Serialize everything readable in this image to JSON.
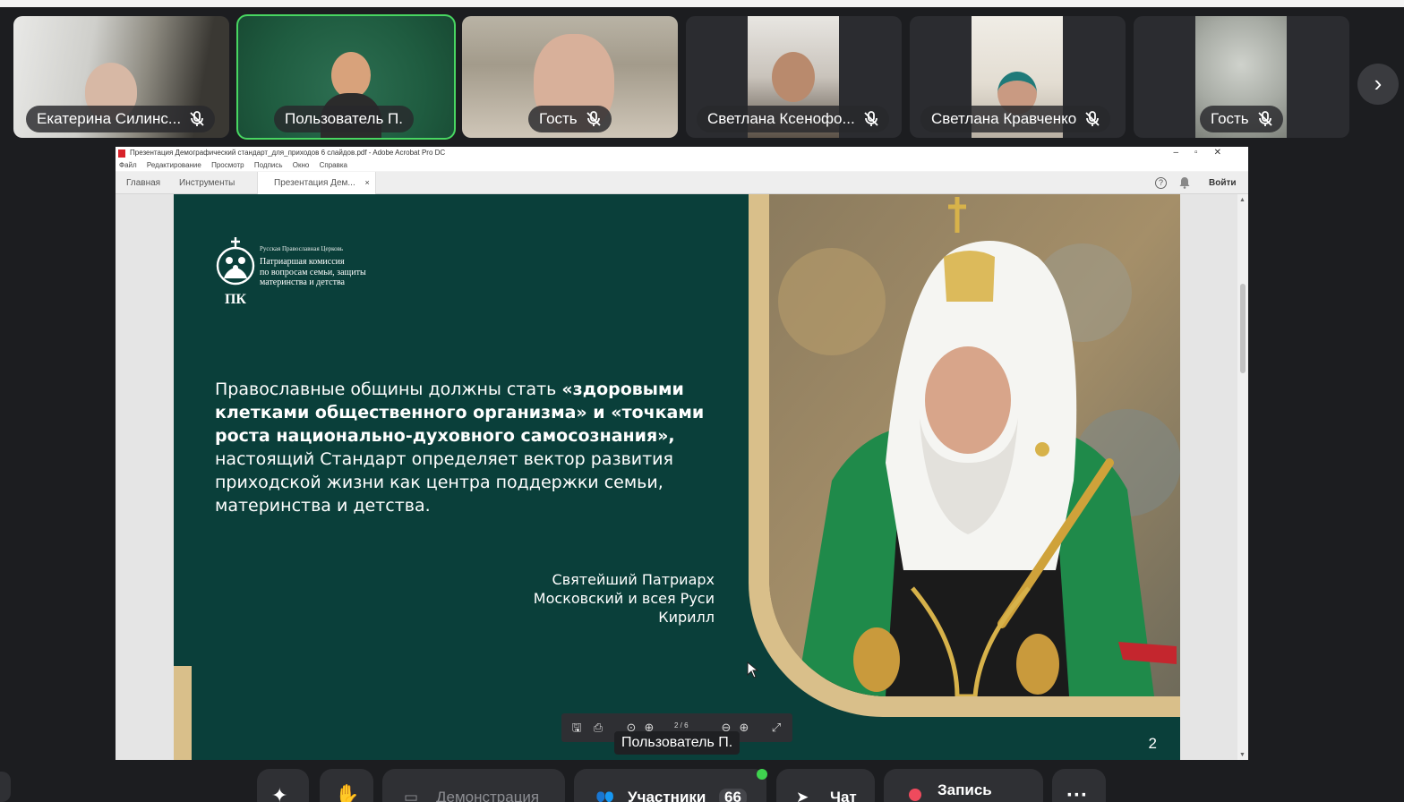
{
  "participants": [
    {
      "name": "Екатерина Силинс...",
      "muted": true,
      "active": false
    },
    {
      "name": "Пользователь П.",
      "muted": false,
      "active": true
    },
    {
      "name": "Гость",
      "muted": true,
      "active": false
    },
    {
      "name": "Светлана Ксенофо...",
      "muted": true,
      "active": false
    },
    {
      "name": "Светлана Кравченко",
      "muted": true,
      "active": false
    },
    {
      "name": "Гость",
      "muted": true,
      "active": false
    }
  ],
  "acrobat": {
    "window_title": "Презентация Демографический стандарт_для_приходов 6 слайдов.pdf - Adobe Acrobat Pro DC",
    "menu": [
      "Файл",
      "Редактирование",
      "Просмотр",
      "Подпись",
      "Окно",
      "Справка"
    ],
    "tabs": {
      "home": "Главная",
      "tools": "Инструменты",
      "doc": "Презентация Дем...",
      "close": "×"
    },
    "login": "Войти",
    "help": "?",
    "page_indicator": "2 / 6"
  },
  "slide": {
    "logo_small": "Русская Православная Церковь",
    "logo_lines": [
      "Патриаршая комиссия",
      "по вопросам семьи, защиты",
      "материнства и детства"
    ],
    "quote_lead": "Православные общины должны стать ",
    "quote_bold": "«здоровыми клетками общественного организма» и «точками роста национально-духовного самосознания»,",
    "quote_rest": " настоящий Стандарт определяет вектор развития приходской жизни как центра поддержки семьи, материнства и детства.",
    "author_lines": [
      "Святейший Патриарх",
      "Московский и всея Руси",
      "Кирилл"
    ],
    "page_number": "2"
  },
  "presenter_label": "Пользователь П.",
  "bottom_bar": {
    "demo": "Демонстрация",
    "participants": "Участники",
    "participants_count": "66",
    "chat": "Чат",
    "record": "Запись"
  },
  "colors": {
    "slide_bg": "#0a3f3a",
    "gold": "#d9bf8a",
    "active_outline": "#48d661",
    "record_red": "#ef4a5d"
  }
}
